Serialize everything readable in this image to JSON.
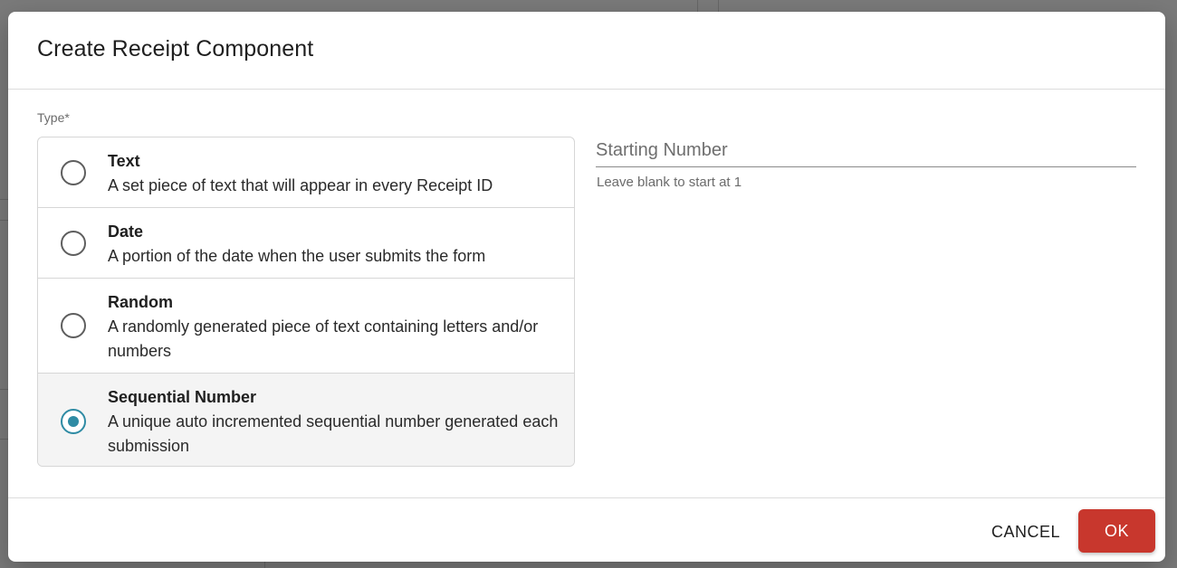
{
  "dialog": {
    "title": "Create Receipt Component"
  },
  "type_field": {
    "label": "Type*",
    "selected": "Sequential Number",
    "options": [
      {
        "title": "Text",
        "description": "A set piece of text that will appear in every Receipt ID"
      },
      {
        "title": "Date",
        "description": "A portion of the date when the user submits the form"
      },
      {
        "title": "Random",
        "description": "A randomly generated piece of text containing letters and/or numbers"
      },
      {
        "title": "Sequential Number",
        "description": "A unique auto incremented sequential number generated each submission"
      }
    ]
  },
  "starting_number": {
    "placeholder": "Starting Number",
    "value": "",
    "helper_text": "Leave blank to start at 1"
  },
  "footer": {
    "cancel_label": "CANCEL",
    "ok_label": "OK"
  },
  "colors": {
    "accent": "#2f8ba4",
    "primary_button": "#c8372d"
  }
}
